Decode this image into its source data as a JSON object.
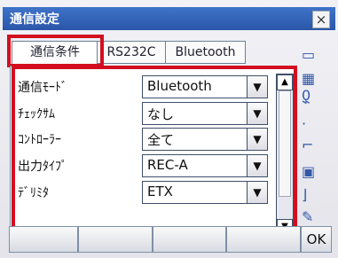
{
  "window": {
    "title": "通信設定",
    "close_label": "×"
  },
  "tabs": [
    {
      "label": "通信条件"
    },
    {
      "label": "RS232C"
    },
    {
      "label": "Bluetooth"
    }
  ],
  "settings": [
    {
      "label": "通信ﾓｰﾄﾞ",
      "value": "Bluetooth"
    },
    {
      "label": "ﾁｪｯｸｻﾑ",
      "value": "なし"
    },
    {
      "label": "ｺﾝﾄﾛｰﾗｰ",
      "value": "全て"
    },
    {
      "label": "出力ﾀｲﾌﾟ",
      "value": "REC-A"
    },
    {
      "label": "ﾃﾞﾘﾐﾀ",
      "value": "ETX"
    }
  ],
  "side_value": "0",
  "softkeys": [
    "",
    "",
    "",
    "",
    "OK"
  ],
  "colors": {
    "highlight": "#d30f1f",
    "title_bar": "#2a56a8"
  }
}
